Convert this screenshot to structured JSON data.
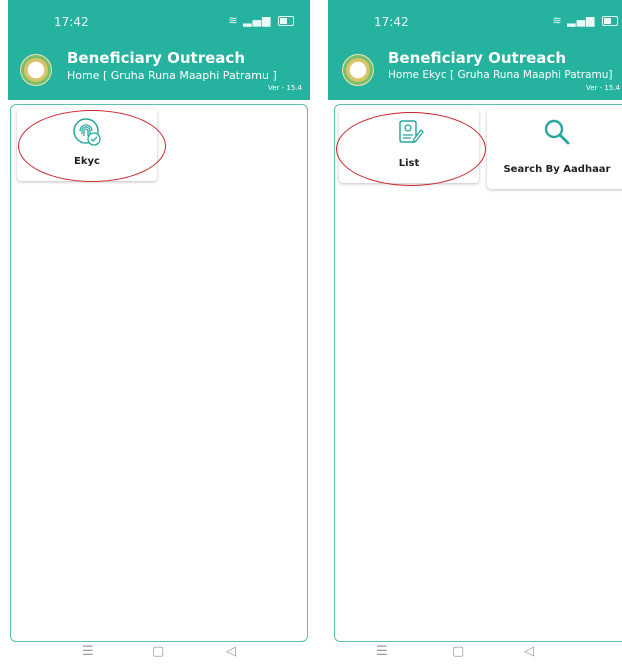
{
  "left": {
    "status": {
      "time": "17:42"
    },
    "header": {
      "title": "Beneficiary Outreach",
      "subtitle": "Home  [ Gruha Runa Maaphi Patramu ]",
      "version": "Ver - 15.4"
    },
    "tiles": [
      {
        "label": "Ekyc",
        "icon": "fingerprint-check-icon"
      }
    ]
  },
  "right": {
    "status": {
      "time": "17:42"
    },
    "header": {
      "title": "Beneficiary Outreach",
      "subtitle": "Home Ekyc [ Gruha Runa Maaphi Patramu]",
      "version": "Ver - 15.4"
    },
    "tiles": [
      {
        "label": "List",
        "icon": "document-edit-icon"
      },
      {
        "label": "Search By Aadhaar",
        "icon": "search-icon"
      }
    ]
  },
  "nav": {
    "menu_glyph": "☰",
    "home_glyph": "▢",
    "back_glyph": "◁"
  },
  "colors": {
    "header": "#25b29e",
    "accent": "#27a89c",
    "highlight_circle": "#c8242c"
  }
}
